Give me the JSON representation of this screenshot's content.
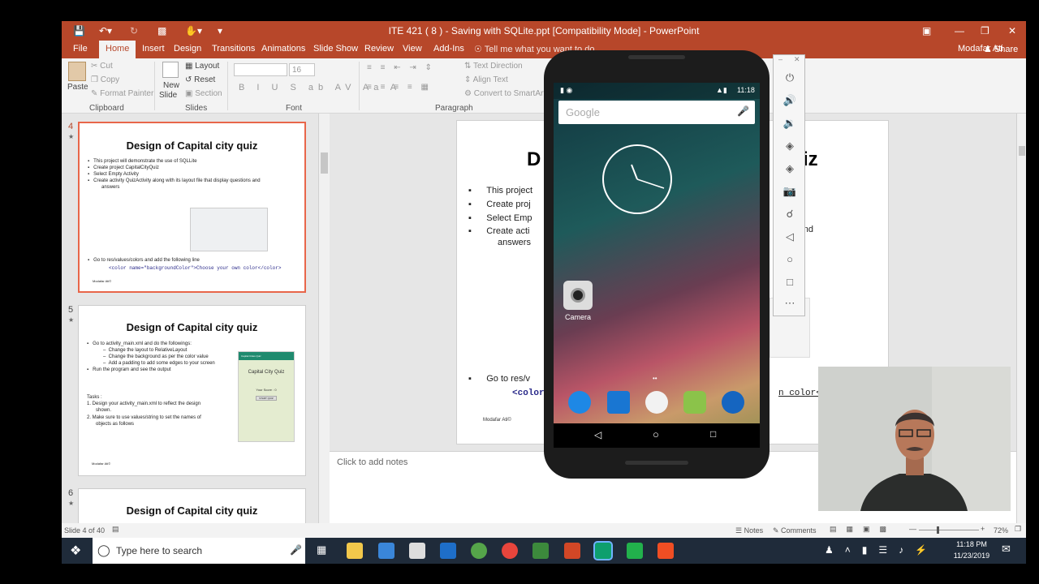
{
  "window": {
    "title": "ITE 421 ( 8 ) - Saving with SQLite.ppt [Compatibility Mode] - PowerPoint",
    "user": "Modafar Ati",
    "share": "Share",
    "tell_me": "Tell me what you want to do..."
  },
  "tabs": [
    "File",
    "Home",
    "Insert",
    "Design",
    "Transitions",
    "Animations",
    "Slide Show",
    "Review",
    "View",
    "Add-Ins"
  ],
  "ribbon": {
    "paste": "Paste",
    "cut": "Cut",
    "copy": "Copy",
    "format_painter": "Format Painter",
    "clipboard": "Clipboard",
    "new_slide": "New",
    "new_slide2": "Slide",
    "layout": "Layout",
    "reset": "Reset",
    "section": "Section",
    "slides": "Slides",
    "font_size": "16",
    "font": "Font",
    "text_direction": "Text Direction",
    "align_text": "Align Text",
    "convert_smartart": "Convert to SmartArt",
    "paragraph": "Paragraph"
  },
  "thumbs": [
    {
      "num": "4",
      "title": "Design of Capital city quiz",
      "bullets": [
        "This project will demonstrate the use of SQLLite",
        "Create project CapitalCityQuiz",
        "Select Empty Activity",
        "Create activity QuizActivity along with its layout file that display questions and",
        "answers"
      ],
      "bottom1": "Go to res/values/colors and add the following line",
      "bottom2": "<color name=\"backgroundColor\">Choose your own color</color>",
      "footer": "Modafar Ati©"
    },
    {
      "num": "5",
      "title": "Design of Capital city quiz",
      "bullets": [
        "Go to activity_main.xml and do the followings:",
        "Change the layout to RelativeLayout",
        "Change the background as per the color value",
        "Add a padding to add some edges to your screen",
        "Run the program and see the output"
      ],
      "tasks": "Tasks :",
      "task1": "1.  Design your activity_main.xml to reflect the design",
      "task1b": "shown.",
      "task2": "2.  Make sure to use values/string to set the names of",
      "task2b": "objects as follows",
      "app_title": "Capital City Quiz",
      "app_header": "Capital Cities Quiz",
      "score": "Your Score : 0",
      "start": "START QUIZ",
      "footer": "Modafar Ati©"
    },
    {
      "num": "6",
      "title": "Design of Capital city quiz"
    }
  ],
  "main_slide": {
    "title_left": "D",
    "title_right": "iz",
    "bullets": [
      "This project",
      "Create proj",
      "Select Emp",
      "Create acti",
      "answers"
    ],
    "right_text": "ns and",
    "goto": "Go to res/v",
    "color": "<color",
    "color_right": "n color</",
    "footer": "Modafar Ati©"
  },
  "notes_placeholder": "Click to add notes",
  "status": {
    "slide": "Slide 4 of 40",
    "notes": "Notes",
    "comments": "Comments",
    "zoom": "72%"
  },
  "taskbar": {
    "search": "Type here to search",
    "time": "11:18 PM",
    "date": "11/23/2019"
  },
  "phone": {
    "time": "11:18",
    "search": "Google",
    "camera": "Camera"
  }
}
